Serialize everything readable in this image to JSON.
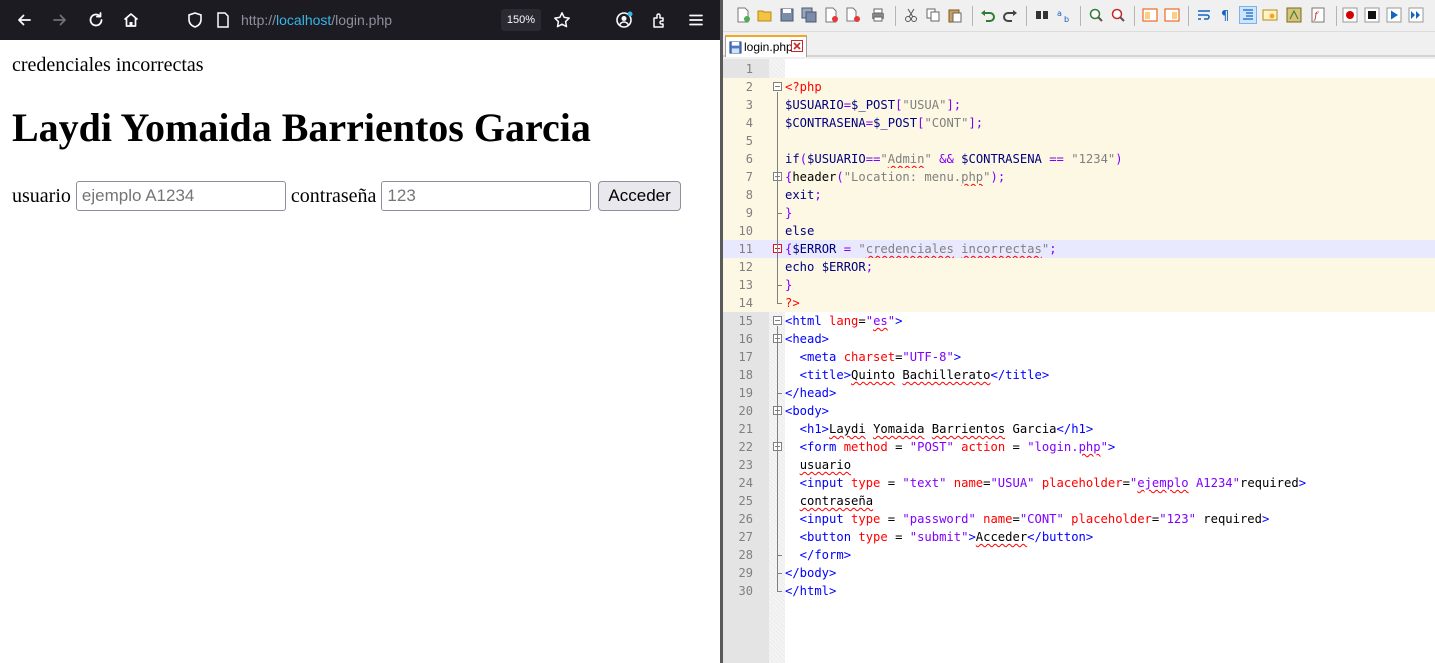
{
  "browser": {
    "url_prefix": "http://",
    "url_host": "localhost",
    "url_path": "/login.php",
    "zoom": "150%",
    "page": {
      "error_text": "credenciales incorrectas",
      "heading": "Laydi Yomaida Barrientos Garcia",
      "usuario_label": "usuario",
      "usuario_placeholder": "ejemplo A1234",
      "contrasena_label": "contraseña",
      "contrasena_placeholder": "123",
      "submit_label": "Acceder"
    }
  },
  "editor": {
    "tab_label": "login.php",
    "lines": [
      {
        "n": "1",
        "seg": []
      },
      {
        "n": "2",
        "seg": [
          {
            "t": "<?php",
            "c": "c-php"
          }
        ]
      },
      {
        "n": "3",
        "seg": [
          {
            "t": "$USUARIO",
            "c": "c-var"
          },
          {
            "t": "=",
            "c": "c-op"
          },
          {
            "t": "$_POST",
            "c": "c-var"
          },
          {
            "t": "[",
            "c": "c-op"
          },
          {
            "t": "\"USUA\"",
            "c": "c-str"
          },
          {
            "t": "];",
            "c": "c-op"
          }
        ]
      },
      {
        "n": "4",
        "seg": [
          {
            "t": "$CONTRASENA",
            "c": "c-var"
          },
          {
            "t": "=",
            "c": "c-op"
          },
          {
            "t": "$_POST",
            "c": "c-var"
          },
          {
            "t": "[",
            "c": "c-op"
          },
          {
            "t": "\"CONT\"",
            "c": "c-str"
          },
          {
            "t": "];",
            "c": "c-op"
          }
        ]
      },
      {
        "n": "5",
        "seg": []
      },
      {
        "n": "6",
        "seg": [
          {
            "t": "if",
            "c": "c-kw"
          },
          {
            "t": "(",
            "c": "c-op"
          },
          {
            "t": "$USUARIO",
            "c": "c-var"
          },
          {
            "t": "==",
            "c": "c-op"
          },
          {
            "t": "\"",
            "c": "c-str"
          },
          {
            "t": "Admin",
            "c": "c-str squig"
          },
          {
            "t": "\"",
            "c": "c-str"
          },
          {
            "t": " && ",
            "c": "c-op"
          },
          {
            "t": "$CONTRASENA",
            "c": "c-var"
          },
          {
            "t": " == ",
            "c": "c-op"
          },
          {
            "t": "\"1234\"",
            "c": "c-str"
          },
          {
            "t": ")",
            "c": "c-op"
          }
        ]
      },
      {
        "n": "7",
        "seg": [
          {
            "t": "{",
            "c": "c-op"
          },
          {
            "t": "header",
            "c": "c-text"
          },
          {
            "t": "(",
            "c": "c-op"
          },
          {
            "t": "\"Location: menu.",
            "c": "c-str"
          },
          {
            "t": "php",
            "c": "c-str squig"
          },
          {
            "t": "\"",
            "c": "c-str"
          },
          {
            "t": ");",
            "c": "c-op"
          }
        ]
      },
      {
        "n": "8",
        "seg": [
          {
            "t": "exit",
            "c": "c-kw"
          },
          {
            "t": ";",
            "c": "c-op"
          }
        ]
      },
      {
        "n": "9",
        "seg": [
          {
            "t": "}",
            "c": "c-op"
          }
        ]
      },
      {
        "n": "10",
        "seg": [
          {
            "t": "else",
            "c": "c-kw"
          }
        ]
      },
      {
        "n": "11",
        "seg": [
          {
            "t": "{",
            "c": "c-op"
          },
          {
            "t": "$ERROR",
            "c": "c-var"
          },
          {
            "t": " = ",
            "c": "c-op"
          },
          {
            "t": "\"",
            "c": "c-str"
          },
          {
            "t": "credenciales",
            "c": "c-str squig"
          },
          {
            "t": " ",
            "c": "c-str"
          },
          {
            "t": "incorrectas",
            "c": "c-str squig"
          },
          {
            "t": "\"",
            "c": "c-str"
          },
          {
            "t": ";",
            "c": "c-op"
          }
        ]
      },
      {
        "n": "12",
        "seg": [
          {
            "t": "echo",
            "c": "c-kw"
          },
          {
            "t": " ",
            "c": "c-text"
          },
          {
            "t": "$ERROR",
            "c": "c-var"
          },
          {
            "t": ";",
            "c": "c-op"
          }
        ]
      },
      {
        "n": "13",
        "seg": [
          {
            "t": "}",
            "c": "c-op"
          }
        ]
      },
      {
        "n": "14",
        "seg": [
          {
            "t": "?>",
            "c": "c-php"
          }
        ]
      },
      {
        "n": "15",
        "seg": [
          {
            "t": "<html",
            "c": "c-tag"
          },
          {
            "t": " lang",
            "c": "c-attr"
          },
          {
            "t": "=",
            "c": "c-text"
          },
          {
            "t": "\"",
            "c": "c-aval"
          },
          {
            "t": "es",
            "c": "c-aval squig"
          },
          {
            "t": "\"",
            "c": "c-aval"
          },
          {
            "t": ">",
            "c": "c-tag"
          }
        ]
      },
      {
        "n": "16",
        "seg": [
          {
            "t": "<head>",
            "c": "c-tag"
          }
        ]
      },
      {
        "n": "17",
        "seg": [
          {
            "t": "  <meta",
            "c": "c-tag"
          },
          {
            "t": " charset",
            "c": "c-attr"
          },
          {
            "t": "=",
            "c": "c-text"
          },
          {
            "t": "\"UTF-8\"",
            "c": "c-aval"
          },
          {
            "t": ">",
            "c": "c-tag"
          }
        ]
      },
      {
        "n": "18",
        "seg": [
          {
            "t": "  <title>",
            "c": "c-tag"
          },
          {
            "t": "Quinto",
            "c": "c-text squig"
          },
          {
            "t": " ",
            "c": "c-text"
          },
          {
            "t": "Bachillerato",
            "c": "c-text squig"
          },
          {
            "t": "</title>",
            "c": "c-tag"
          }
        ]
      },
      {
        "n": "19",
        "seg": [
          {
            "t": "</head>",
            "c": "c-tag"
          }
        ]
      },
      {
        "n": "20",
        "seg": [
          {
            "t": "<body>",
            "c": "c-tag"
          }
        ]
      },
      {
        "n": "21",
        "seg": [
          {
            "t": "  <h1>",
            "c": "c-tag"
          },
          {
            "t": "Laydi",
            "c": "c-text squig"
          },
          {
            "t": " ",
            "c": "c-text"
          },
          {
            "t": "Yomaida",
            "c": "c-text squig"
          },
          {
            "t": " ",
            "c": "c-text"
          },
          {
            "t": "Barrientos",
            "c": "c-text squig"
          },
          {
            "t": " Garcia",
            "c": "c-text"
          },
          {
            "t": "</h1>",
            "c": "c-tag"
          }
        ]
      },
      {
        "n": "22",
        "seg": [
          {
            "t": "  <form",
            "c": "c-tag"
          },
          {
            "t": " method",
            "c": "c-attr"
          },
          {
            "t": " = ",
            "c": "c-text"
          },
          {
            "t": "\"POST\"",
            "c": "c-aval"
          },
          {
            "t": " action",
            "c": "c-attr"
          },
          {
            "t": " = ",
            "c": "c-text"
          },
          {
            "t": "\"login.",
            "c": "c-aval"
          },
          {
            "t": "php",
            "c": "c-aval squig"
          },
          {
            "t": "\"",
            "c": "c-aval"
          },
          {
            "t": ">",
            "c": "c-tag"
          }
        ]
      },
      {
        "n": "23",
        "seg": [
          {
            "t": "  ",
            "c": "c-text"
          },
          {
            "t": "usuario",
            "c": "c-text squig"
          }
        ]
      },
      {
        "n": "24",
        "seg": [
          {
            "t": "  <input",
            "c": "c-tag"
          },
          {
            "t": " type",
            "c": "c-attr"
          },
          {
            "t": " = ",
            "c": "c-text"
          },
          {
            "t": "\"text\"",
            "c": "c-aval"
          },
          {
            "t": " name",
            "c": "c-attr"
          },
          {
            "t": "=",
            "c": "c-text"
          },
          {
            "t": "\"USUA\"",
            "c": "c-aval"
          },
          {
            "t": " placeholder",
            "c": "c-attr"
          },
          {
            "t": "=",
            "c": "c-text"
          },
          {
            "t": "\"",
            "c": "c-aval"
          },
          {
            "t": "ejemplo",
            "c": "c-aval squig"
          },
          {
            "t": " A1234\"",
            "c": "c-aval"
          },
          {
            "t": "required",
            "c": "c-text"
          },
          {
            "t": ">",
            "c": "c-tag"
          }
        ]
      },
      {
        "n": "25",
        "seg": [
          {
            "t": "  ",
            "c": "c-text"
          },
          {
            "t": "contraseña",
            "c": "c-text squig"
          }
        ]
      },
      {
        "n": "26",
        "seg": [
          {
            "t": "  <input",
            "c": "c-tag"
          },
          {
            "t": " type",
            "c": "c-attr"
          },
          {
            "t": " = ",
            "c": "c-text"
          },
          {
            "t": "\"password\"",
            "c": "c-aval"
          },
          {
            "t": " name",
            "c": "c-attr"
          },
          {
            "t": "=",
            "c": "c-text"
          },
          {
            "t": "\"CONT\"",
            "c": "c-aval"
          },
          {
            "t": " placeholder",
            "c": "c-attr"
          },
          {
            "t": "=",
            "c": "c-text"
          },
          {
            "t": "\"123\"",
            "c": "c-aval"
          },
          {
            "t": " required",
            "c": "c-text"
          },
          {
            "t": ">",
            "c": "c-tag"
          }
        ]
      },
      {
        "n": "27",
        "seg": [
          {
            "t": "  <button",
            "c": "c-tag"
          },
          {
            "t": " type",
            "c": "c-attr"
          },
          {
            "t": " = ",
            "c": "c-text"
          },
          {
            "t": "\"submit\"",
            "c": "c-aval"
          },
          {
            "t": ">",
            "c": "c-tag"
          },
          {
            "t": "Acceder",
            "c": "c-text squig"
          },
          {
            "t": "</button>",
            "c": "c-tag"
          }
        ]
      },
      {
        "n": "28",
        "seg": [
          {
            "t": "  </form>",
            "c": "c-tag"
          }
        ]
      },
      {
        "n": "29",
        "seg": [
          {
            "t": "</body>",
            "c": "c-tag"
          }
        ]
      },
      {
        "n": "30",
        "seg": [
          {
            "t": "</html>",
            "c": "c-tag"
          }
        ]
      }
    ]
  },
  "colors": {
    "browser_toolbar": "#1c1b22",
    "url_host": "#38b6e6",
    "php_block_bg": "#fdf8e3",
    "current_line_bg": "#e8e8ff",
    "tab_accent": "#f5a623"
  }
}
